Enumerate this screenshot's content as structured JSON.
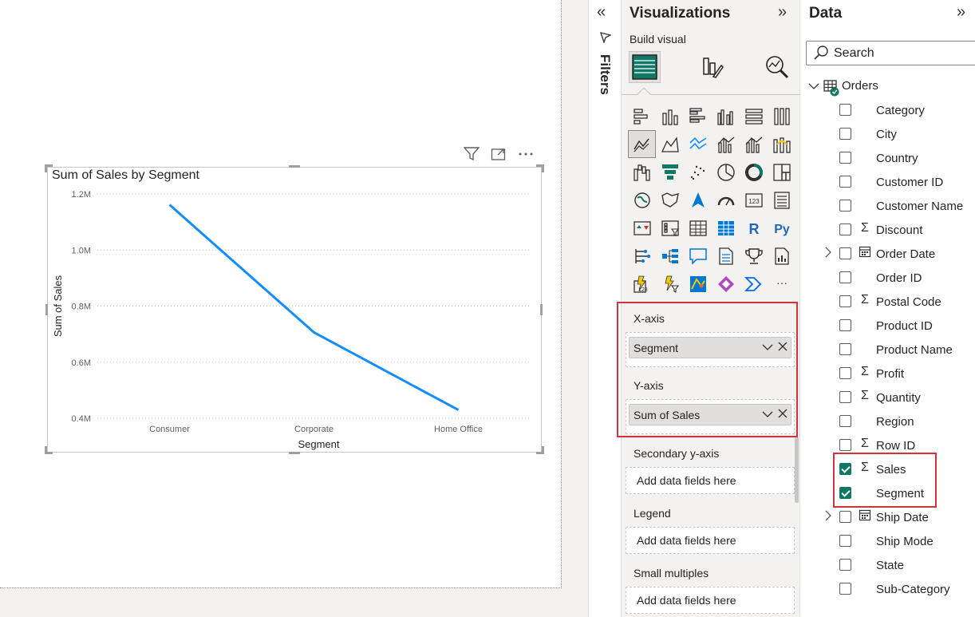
{
  "canvas": {
    "visual_header_icons": [
      "filter-icon",
      "focus-mode-icon",
      "more-options-icon"
    ],
    "chart_title": "Sum of Sales by Segment"
  },
  "chart_data": {
    "type": "line",
    "title": "Sum of Sales by Segment",
    "xlabel": "Segment",
    "ylabel": "Sum of Sales",
    "categories": [
      "Consumer",
      "Corporate",
      "Home Office"
    ],
    "series": [
      {
        "values": [
          1161401,
          706146,
          429653
        ]
      }
    ],
    "ylim": [
      400000,
      1200000
    ],
    "yticks": [
      400000,
      600000,
      800000,
      1000000,
      1200000
    ],
    "ytick_labels": [
      "0.4M",
      "0.6M",
      "0.8M",
      "1.0M",
      "1.2M"
    ],
    "grid": true,
    "color": "#118DFF"
  },
  "filters": {
    "label": "Filters"
  },
  "visualizations": {
    "title": "Visualizations",
    "build_visual": "Build visual",
    "wells": {
      "x_axis": {
        "label": "X-axis",
        "field": "Segment"
      },
      "y_axis": {
        "label": "Y-axis",
        "field": "Sum of Sales"
      },
      "secondary_y": {
        "label": "Secondary y-axis",
        "placeholder": "Add data fields here"
      },
      "legend": {
        "label": "Legend",
        "placeholder": "Add data fields here"
      },
      "small_multiples": {
        "label": "Small multiples",
        "placeholder": "Add data fields here"
      }
    },
    "gallery": [
      "stacked-bar-chart",
      "stacked-column-chart",
      "clustered-bar-chart",
      "clustered-column-chart",
      "100-stacked-bar-chart",
      "100-stacked-column-chart",
      "line-chart",
      "area-chart",
      "stacked-area-chart",
      "line-and-stacked-column-chart",
      "line-and-clustered-column-chart",
      "ribbon-chart",
      "waterfall-chart",
      "funnel-chart",
      "scatter-chart",
      "pie-chart",
      "donut-chart",
      "treemap",
      "map",
      "filled-map",
      "azure-map",
      "gauge",
      "card",
      "multi-row-card",
      "kpi",
      "slicer",
      "table",
      "matrix",
      "r-script-visual",
      "python-visual",
      "key-influencers",
      "decomposition-tree",
      "q-and-a",
      "smart-narrative",
      "metrics",
      "paginated-report",
      "power-apps",
      "power-automate",
      "arcgis-map",
      "get-more-visuals",
      "power-automate-alt",
      "more-visuals"
    ],
    "gallery_text": {
      "r": "R",
      "py": "Py",
      "more": "···",
      "card": "123"
    }
  },
  "data": {
    "title": "Data",
    "search_placeholder": "Search",
    "table": "Orders",
    "fields": [
      {
        "name": "Category",
        "type": "",
        "checked": false,
        "expandable": false
      },
      {
        "name": "City",
        "type": "",
        "checked": false,
        "expandable": false
      },
      {
        "name": "Country",
        "type": "",
        "checked": false,
        "expandable": false
      },
      {
        "name": "Customer ID",
        "type": "",
        "checked": false,
        "expandable": false
      },
      {
        "name": "Customer Name",
        "type": "",
        "checked": false,
        "expandable": false
      },
      {
        "name": "Discount",
        "type": "Σ",
        "checked": false,
        "expandable": false
      },
      {
        "name": "Order Date",
        "type": "calendar",
        "checked": false,
        "expandable": true
      },
      {
        "name": "Order ID",
        "type": "",
        "checked": false,
        "expandable": false
      },
      {
        "name": "Postal Code",
        "type": "Σ",
        "checked": false,
        "expandable": false
      },
      {
        "name": "Product ID",
        "type": "",
        "checked": false,
        "expandable": false
      },
      {
        "name": "Product Name",
        "type": "",
        "checked": false,
        "expandable": false
      },
      {
        "name": "Profit",
        "type": "Σ",
        "checked": false,
        "expandable": false
      },
      {
        "name": "Quantity",
        "type": "Σ",
        "checked": false,
        "expandable": false
      },
      {
        "name": "Region",
        "type": "",
        "checked": false,
        "expandable": false
      },
      {
        "name": "Row ID",
        "type": "Σ",
        "checked": false,
        "expandable": false
      },
      {
        "name": "Sales",
        "type": "Σ",
        "checked": true,
        "expandable": false
      },
      {
        "name": "Segment",
        "type": "",
        "checked": true,
        "expandable": false
      },
      {
        "name": "Ship Date",
        "type": "calendar",
        "checked": false,
        "expandable": true
      },
      {
        "name": "Ship Mode",
        "type": "",
        "checked": false,
        "expandable": false
      },
      {
        "name": "State",
        "type": "",
        "checked": false,
        "expandable": false
      },
      {
        "name": "Sub-Category",
        "type": "",
        "checked": false,
        "expandable": false
      }
    ]
  },
  "colors": {
    "accent": "#117865",
    "line": "#118DFF",
    "highlight": "#D13438"
  }
}
